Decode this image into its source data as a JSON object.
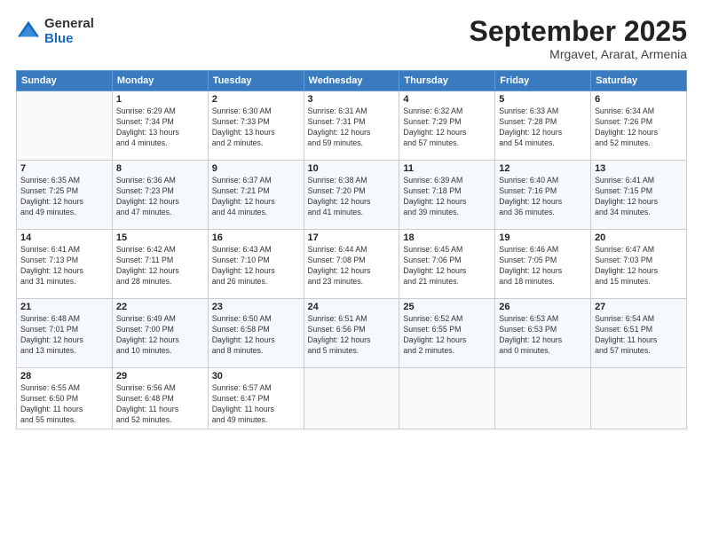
{
  "header": {
    "logo": {
      "general": "General",
      "blue": "Blue"
    },
    "month": "September 2025",
    "location": "Mrgavet, Ararat, Armenia"
  },
  "weekdays": [
    "Sunday",
    "Monday",
    "Tuesday",
    "Wednesday",
    "Thursday",
    "Friday",
    "Saturday"
  ],
  "weeks": [
    [
      {
        "day": "",
        "info": ""
      },
      {
        "day": "1",
        "info": "Sunrise: 6:29 AM\nSunset: 7:34 PM\nDaylight: 13 hours\nand 4 minutes."
      },
      {
        "day": "2",
        "info": "Sunrise: 6:30 AM\nSunset: 7:33 PM\nDaylight: 13 hours\nand 2 minutes."
      },
      {
        "day": "3",
        "info": "Sunrise: 6:31 AM\nSunset: 7:31 PM\nDaylight: 12 hours\nand 59 minutes."
      },
      {
        "day": "4",
        "info": "Sunrise: 6:32 AM\nSunset: 7:29 PM\nDaylight: 12 hours\nand 57 minutes."
      },
      {
        "day": "5",
        "info": "Sunrise: 6:33 AM\nSunset: 7:28 PM\nDaylight: 12 hours\nand 54 minutes."
      },
      {
        "day": "6",
        "info": "Sunrise: 6:34 AM\nSunset: 7:26 PM\nDaylight: 12 hours\nand 52 minutes."
      }
    ],
    [
      {
        "day": "7",
        "info": "Sunrise: 6:35 AM\nSunset: 7:25 PM\nDaylight: 12 hours\nand 49 minutes."
      },
      {
        "day": "8",
        "info": "Sunrise: 6:36 AM\nSunset: 7:23 PM\nDaylight: 12 hours\nand 47 minutes."
      },
      {
        "day": "9",
        "info": "Sunrise: 6:37 AM\nSunset: 7:21 PM\nDaylight: 12 hours\nand 44 minutes."
      },
      {
        "day": "10",
        "info": "Sunrise: 6:38 AM\nSunset: 7:20 PM\nDaylight: 12 hours\nand 41 minutes."
      },
      {
        "day": "11",
        "info": "Sunrise: 6:39 AM\nSunset: 7:18 PM\nDaylight: 12 hours\nand 39 minutes."
      },
      {
        "day": "12",
        "info": "Sunrise: 6:40 AM\nSunset: 7:16 PM\nDaylight: 12 hours\nand 36 minutes."
      },
      {
        "day": "13",
        "info": "Sunrise: 6:41 AM\nSunset: 7:15 PM\nDaylight: 12 hours\nand 34 minutes."
      }
    ],
    [
      {
        "day": "14",
        "info": "Sunrise: 6:41 AM\nSunset: 7:13 PM\nDaylight: 12 hours\nand 31 minutes."
      },
      {
        "day": "15",
        "info": "Sunrise: 6:42 AM\nSunset: 7:11 PM\nDaylight: 12 hours\nand 28 minutes."
      },
      {
        "day": "16",
        "info": "Sunrise: 6:43 AM\nSunset: 7:10 PM\nDaylight: 12 hours\nand 26 minutes."
      },
      {
        "day": "17",
        "info": "Sunrise: 6:44 AM\nSunset: 7:08 PM\nDaylight: 12 hours\nand 23 minutes."
      },
      {
        "day": "18",
        "info": "Sunrise: 6:45 AM\nSunset: 7:06 PM\nDaylight: 12 hours\nand 21 minutes."
      },
      {
        "day": "19",
        "info": "Sunrise: 6:46 AM\nSunset: 7:05 PM\nDaylight: 12 hours\nand 18 minutes."
      },
      {
        "day": "20",
        "info": "Sunrise: 6:47 AM\nSunset: 7:03 PM\nDaylight: 12 hours\nand 15 minutes."
      }
    ],
    [
      {
        "day": "21",
        "info": "Sunrise: 6:48 AM\nSunset: 7:01 PM\nDaylight: 12 hours\nand 13 minutes."
      },
      {
        "day": "22",
        "info": "Sunrise: 6:49 AM\nSunset: 7:00 PM\nDaylight: 12 hours\nand 10 minutes."
      },
      {
        "day": "23",
        "info": "Sunrise: 6:50 AM\nSunset: 6:58 PM\nDaylight: 12 hours\nand 8 minutes."
      },
      {
        "day": "24",
        "info": "Sunrise: 6:51 AM\nSunset: 6:56 PM\nDaylight: 12 hours\nand 5 minutes."
      },
      {
        "day": "25",
        "info": "Sunrise: 6:52 AM\nSunset: 6:55 PM\nDaylight: 12 hours\nand 2 minutes."
      },
      {
        "day": "26",
        "info": "Sunrise: 6:53 AM\nSunset: 6:53 PM\nDaylight: 12 hours\nand 0 minutes."
      },
      {
        "day": "27",
        "info": "Sunrise: 6:54 AM\nSunset: 6:51 PM\nDaylight: 11 hours\nand 57 minutes."
      }
    ],
    [
      {
        "day": "28",
        "info": "Sunrise: 6:55 AM\nSunset: 6:50 PM\nDaylight: 11 hours\nand 55 minutes."
      },
      {
        "day": "29",
        "info": "Sunrise: 6:56 AM\nSunset: 6:48 PM\nDaylight: 11 hours\nand 52 minutes."
      },
      {
        "day": "30",
        "info": "Sunrise: 6:57 AM\nSunset: 6:47 PM\nDaylight: 11 hours\nand 49 minutes."
      },
      {
        "day": "",
        "info": ""
      },
      {
        "day": "",
        "info": ""
      },
      {
        "day": "",
        "info": ""
      },
      {
        "day": "",
        "info": ""
      }
    ]
  ]
}
